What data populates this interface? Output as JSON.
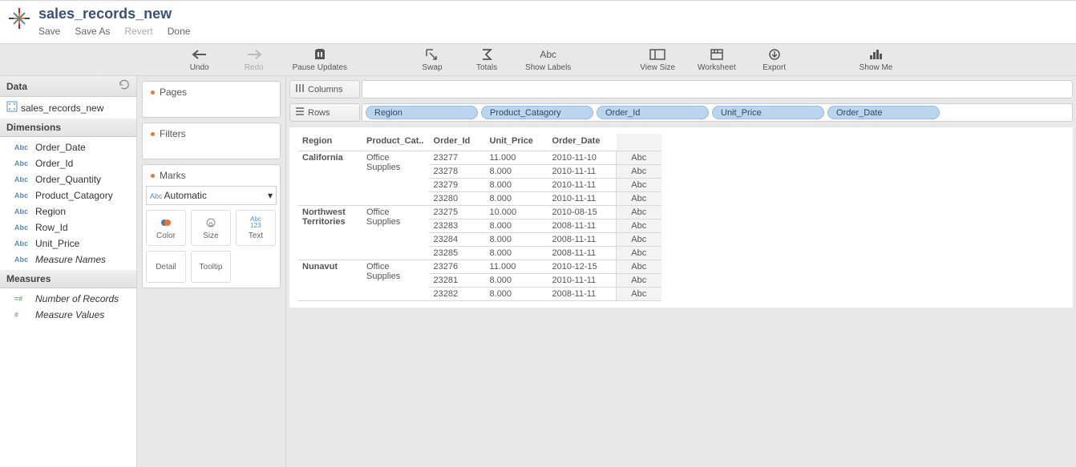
{
  "header": {
    "title": "sales_records_new"
  },
  "menu": {
    "save": "Save",
    "saveAs": "Save As",
    "revert": "Revert",
    "done": "Done"
  },
  "toolbar": {
    "undo": "Undo",
    "redo": "Redo",
    "pause": "Pause Updates",
    "swap": "Swap",
    "totals": "Totals",
    "labels": "Show Labels",
    "viewsize": "View Size",
    "worksheet": "Worksheet",
    "export": "Export",
    "showme": "Show Me"
  },
  "side": {
    "data_hd": "Data",
    "datasource": "sales_records_new",
    "dim_hd": "Dimensions",
    "dims": [
      {
        "t": "Abc",
        "lbl": "Order_Date"
      },
      {
        "t": "Abc",
        "lbl": "Order_Id"
      },
      {
        "t": "Abc",
        "lbl": "Order_Quantity"
      },
      {
        "t": "Abc",
        "lbl": "Product_Catagory"
      },
      {
        "t": "Abc",
        "lbl": "Region"
      },
      {
        "t": "Abc",
        "lbl": "Row_Id"
      },
      {
        "t": "Abc",
        "lbl": "Unit_Price"
      },
      {
        "t": "Abc",
        "lbl": "Measure Names",
        "i": true
      }
    ],
    "meas_hd": "Measures",
    "meas": [
      {
        "t": "=#",
        "lbl": "Number of Records",
        "i": true
      },
      {
        "t": "#",
        "lbl": "Measure Values",
        "i": true
      }
    ]
  },
  "pane": {
    "pages": "Pages",
    "filters": "Filters",
    "marks": "Marks",
    "autoType": "Automatic",
    "autoPrefix": "Abc",
    "color": "Color",
    "size": "Size",
    "text": "Text",
    "detail": "Detail",
    "tooltip": "Tooltip",
    "textPrefix": "Abc\n123"
  },
  "shelves": {
    "columns": "Columns",
    "rows": "Rows",
    "rowPills": [
      "Region",
      "Product_Catagory",
      "Order_Id",
      "Unit_Price",
      "Order_Date"
    ]
  },
  "table": {
    "headers": {
      "region": "Region",
      "pc": "Product_Cat..",
      "oid": "Order_Id",
      "up": "Unit_Price",
      "od": "Order_Date"
    },
    "abc": "Abc",
    "groups": [
      {
        "region": "California",
        "pc": "Office Supplies",
        "rows": [
          {
            "oid": "23277",
            "up": "11.000",
            "od": "2010-11-10"
          },
          {
            "oid": "23278",
            "up": "8.000",
            "od": "2010-11-11"
          },
          {
            "oid": "23279",
            "up": "8.000",
            "od": "2010-11-11"
          },
          {
            "oid": "23280",
            "up": "8.000",
            "od": "2010-11-11"
          }
        ]
      },
      {
        "region": "Northwest Territories",
        "pc": "Office Supplies",
        "rows": [
          {
            "oid": "23275",
            "up": "10.000",
            "od": "2010-08-15"
          },
          {
            "oid": "23283",
            "up": "8.000",
            "od": "2008-11-11"
          },
          {
            "oid": "23284",
            "up": "8.000",
            "od": "2008-11-11"
          },
          {
            "oid": "23285",
            "up": "8.000",
            "od": "2008-11-11"
          }
        ]
      },
      {
        "region": "Nunavut",
        "pc": "Office Supplies",
        "rows": [
          {
            "oid": "23276",
            "up": "11.000",
            "od": "2010-12-15"
          },
          {
            "oid": "23281",
            "up": "8.000",
            "od": "2010-11-11"
          },
          {
            "oid": "23282",
            "up": "8.000",
            "od": "2008-11-11"
          }
        ]
      }
    ]
  }
}
